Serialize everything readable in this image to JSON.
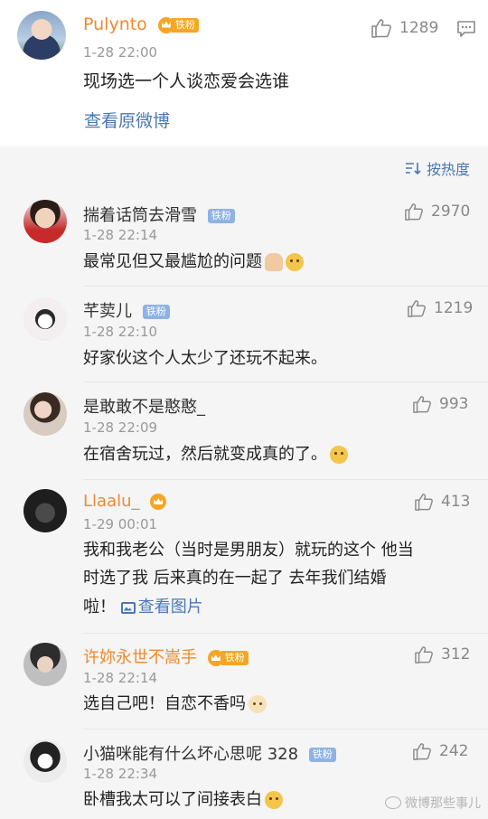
{
  "post": {
    "username": "Pulynto",
    "badge": "铁粉",
    "time": "1-28 22:00",
    "text": "现场选一个人谈恋爱会选谁",
    "view_original": "查看原微博",
    "likes": "1289"
  },
  "sort": {
    "label": "按热度"
  },
  "comments": [
    {
      "username": "揣着话筒去滑雪",
      "badge": "铁粉",
      "time": "1-28 22:14",
      "text": "最常见但又最尴尬的问题",
      "likes": "2970"
    },
    {
      "username": "芊荬儿",
      "badge": "铁粉",
      "time": "1-28 22:10",
      "text": "好家伙这个人太少了还玩不起来。",
      "likes": "1219"
    },
    {
      "username": "是敢敢不是憨憨_",
      "time": "1-28 22:09",
      "text": "在宿舍玩过，然后就变成真的了。",
      "likes": "993"
    },
    {
      "username": "Llaalu_",
      "time": "1-29 00:01",
      "text_line1": "我和我老公（当时是男朋友）就玩的这个 他当",
      "text_line2": "时选了我 后来真的在一起了 去年我们结婚",
      "text_line3": "啦！",
      "view_image": "查看图片",
      "likes": "413"
    },
    {
      "username": "许妳永世不嵩手",
      "badge": "铁粉",
      "time": "1-28 22:14",
      "text": "选自己吧！自恋不香吗",
      "likes": "312"
    },
    {
      "username": "小猫咪能有什么坏心思呢 328",
      "badge": "铁粉",
      "time": "1-28 22:34",
      "text": "卧槽我太可以了间接表白",
      "likes": "242"
    }
  ],
  "watermark": "微博那些事儿",
  "colors": {
    "orange_name": "#ef8a2e",
    "link_blue": "#4a78b4",
    "badge_blue": "#8fb2e4",
    "badge_orange": "#f5a623"
  }
}
